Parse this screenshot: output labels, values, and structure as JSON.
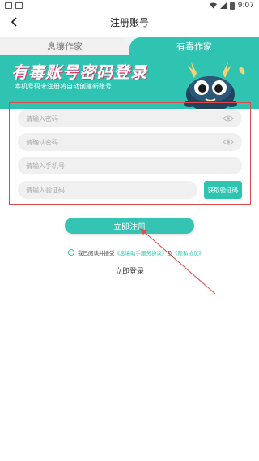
{
  "status_bar": {
    "time": "9:07"
  },
  "nav": {
    "title": "注册账号"
  },
  "tabs": [
    {
      "label": "息壤作家",
      "active": false
    },
    {
      "label": "有毒作家",
      "active": true
    }
  ],
  "banner": {
    "title": "有毒账号密码登录",
    "subtitle": "本机号码未注册将自动创建新账号"
  },
  "form": {
    "password_placeholder": "请输入密码",
    "confirm_placeholder": "请确认密码",
    "phone_placeholder": "请输入手机号",
    "code_placeholder": "请输入验证码",
    "get_code_label": "获取验证码"
  },
  "register_label": "立即注册",
  "agreement": {
    "prefix": "我已阅读并接受",
    "link1": "《息壤助手服务协议》",
    "and": "及",
    "link2": "《隐私协议》"
  },
  "login_label": "立即登录",
  "colors": {
    "accent": "#2fc4b2",
    "highlight": "#e04a4a"
  }
}
